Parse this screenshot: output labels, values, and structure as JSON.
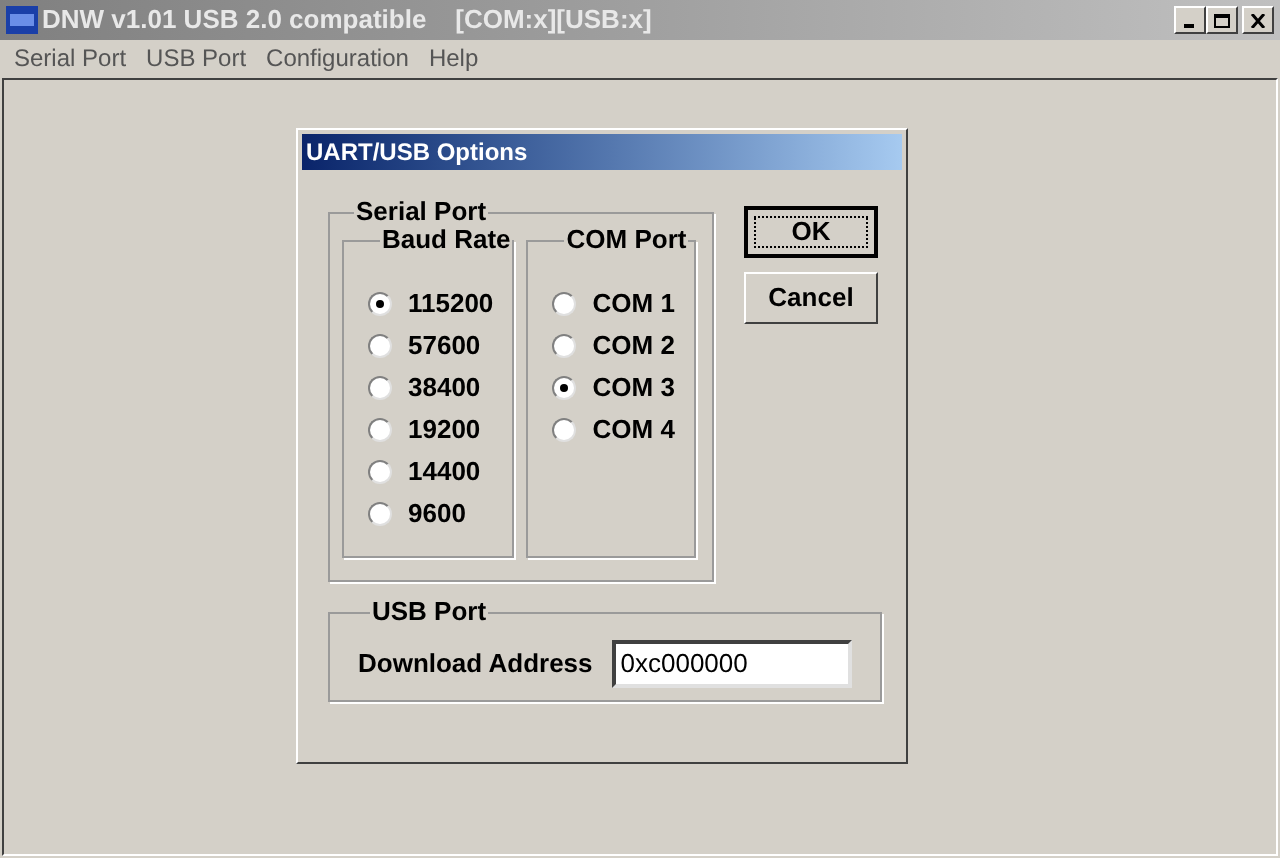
{
  "window": {
    "title": "DNW v1.01 USB 2.0 compatible    [COM:x][USB:x]"
  },
  "menu": [
    "Serial Port",
    "USB Port",
    "Configuration",
    "Help"
  ],
  "dialog": {
    "title": "UART/USB Options",
    "serial_port": {
      "label": "Serial Port",
      "baud_rate": {
        "label": "Baud Rate",
        "options": [
          {
            "label": "115200",
            "selected": true
          },
          {
            "label": "57600",
            "selected": false
          },
          {
            "label": "38400",
            "selected": false
          },
          {
            "label": "19200",
            "selected": false
          },
          {
            "label": "14400",
            "selected": false
          },
          {
            "label": "9600",
            "selected": false
          }
        ]
      },
      "com_port": {
        "label": "COM Port",
        "options": [
          {
            "label": "COM 1",
            "selected": false
          },
          {
            "label": "COM 2",
            "selected": false
          },
          {
            "label": "COM 3",
            "selected": true
          },
          {
            "label": "COM 4",
            "selected": false
          }
        ]
      }
    },
    "usb_port": {
      "label": "USB Port",
      "field_label": "Download Address",
      "value": "0xc000000"
    },
    "buttons": [
      {
        "label": "OK",
        "default": true
      },
      {
        "label": "Cancel",
        "default": false
      }
    ]
  }
}
